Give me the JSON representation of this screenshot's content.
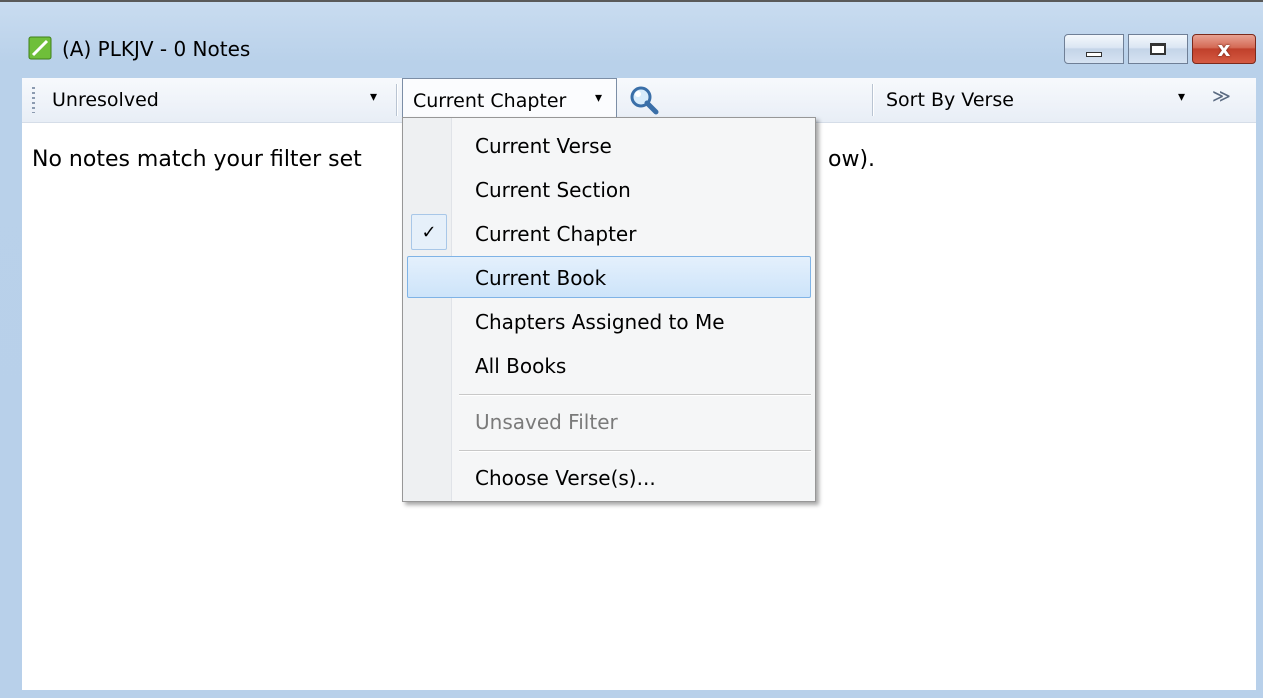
{
  "window": {
    "title": "(A) PLKJV - 0 Notes",
    "controls": {
      "minimize": "",
      "maximize": "",
      "close": "x"
    }
  },
  "toolbar": {
    "status_filter": "Unresolved",
    "scope_filter": "Current Chapter",
    "sort": "Sort By Verse",
    "dropdown_arrow": "▾",
    "overflow": "≫"
  },
  "content": {
    "message_left": "No notes match your filter set",
    "message_right": "ow)."
  },
  "menu": {
    "items": [
      {
        "label": "Current Verse"
      },
      {
        "label": "Current Section"
      },
      {
        "label": "Current Chapter",
        "checked": true
      },
      {
        "label": "Current Book",
        "highlighted": true
      },
      {
        "label": "Chapters Assigned to Me"
      },
      {
        "label": "All Books"
      },
      {
        "label": "Unsaved Filter",
        "disabled": true
      },
      {
        "label": "Choose Verse(s)..."
      }
    ],
    "check_glyph": "✓"
  },
  "colors": {
    "frame": "#b9d1ea",
    "highlight_fill": "#cde4fa",
    "highlight_border": "#7fb3e6",
    "close_button": "#c0402b"
  },
  "icons": [
    "app-notes-icon",
    "search-icon",
    "check-icon",
    "chevron-down-icon",
    "overflow-chevron-icon"
  ]
}
